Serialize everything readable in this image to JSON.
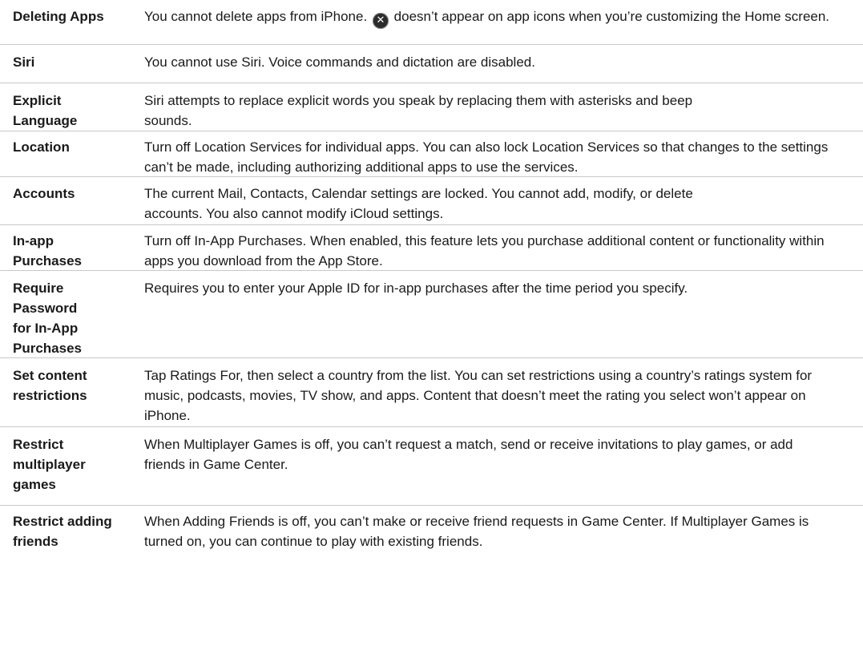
{
  "rows": [
    {
      "term": "Deleting Apps",
      "desc_before": "You cannot delete apps from iPhone.",
      "desc_after": "doesn’t appear on app icons when you’re customizing the Home screen.",
      "icon": "close-circle-icon"
    },
    {
      "term": "Siri",
      "desc": "You cannot use Siri. Voice commands and dictation are disabled."
    },
    {
      "term": "Explicit Language",
      "desc": "Siri attempts to replace explicit words you speak by replacing them with asterisks and beep sounds."
    },
    {
      "term": "Location",
      "desc": "Turn off Location Services for individual apps. You can also lock Location Services so that changes to the settings can’t be made, including authorizing additional apps to use the services."
    },
    {
      "term": "Accounts",
      "desc": "The current Mail, Contacts, Calendar settings are locked. You cannot add, modify, or delete accounts. You also cannot modify iCloud settings."
    },
    {
      "term": "In-app Purchases",
      "desc": "Turn off In-App Purchases. When enabled, this feature lets you purchase additional content or functionality within apps you download from the App Store."
    },
    {
      "term": "Require Password for In-App Purchases",
      "desc": "Requires you to enter your Apple ID for in-app purchases after the time period you specify."
    },
    {
      "term": "Set content restrictions",
      "desc": "Tap Ratings For, then select a country from the list. You can set restrictions using a country’s ratings system for music, podcasts, movies, TV show, and apps. Content that doesn’t meet the rating you select won’t appear on iPhone."
    },
    {
      "term": "Restrict multiplayer games",
      "desc": "When Multiplayer Games is off, you can’t request a match, send or receive invitations to play games, or add friends in Game Center."
    },
    {
      "term": "Restrict adding friends",
      "desc": "When Adding Friends is off, you can’t make or receive friend requests in Game Center. If Multiplayer Games is turned on, you can continue to play with existing friends."
    }
  ],
  "colors": {
    "text": "#1a1a1a",
    "divider": "#c8c8c8",
    "icon_bg": "#2b2b2b"
  }
}
